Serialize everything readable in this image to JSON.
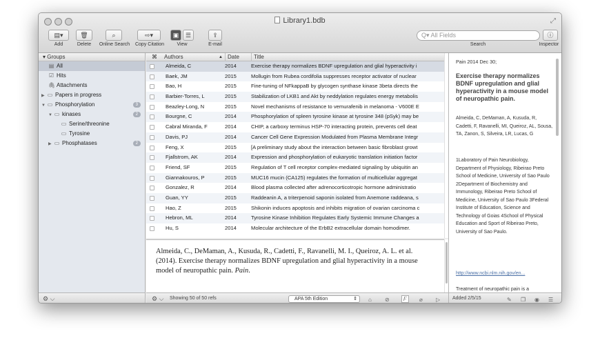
{
  "window": {
    "title": "Library1.bdb",
    "fullscreen_icon": "fullscreen-icon"
  },
  "toolbar": {
    "add_label": "Add",
    "add_glyph": "▤▾",
    "delete_label": "Delete",
    "delete_glyph": "🗑",
    "online_search_label": "Online Search",
    "online_search_glyph": "⌕",
    "copy_citation_label": "Copy Citation",
    "copy_citation_glyph": "⇨▾",
    "view_label": "View",
    "view_glyph_1": "▣",
    "view_glyph_2": "☰",
    "email_label": "E-mail",
    "email_glyph": "⇪",
    "search_placeholder": "Q▾ All Fields",
    "search_label": "Search",
    "inspector_label": "Inspector",
    "inspector_glyph": "ⓘ"
  },
  "sidebar": {
    "header": "Groups",
    "items": [
      {
        "label": "All",
        "icon": "▤"
      },
      {
        "label": "Hits",
        "icon": "☑"
      },
      {
        "label": "Attachments",
        "icon": "🖇"
      },
      {
        "label": "Papers in progress",
        "icon": "▭",
        "tri": "▶"
      },
      {
        "label": "Phosphorylation",
        "icon": "▭",
        "tri": "▼",
        "badge": "3"
      },
      {
        "label": "kinases",
        "icon": "▭",
        "tri": "▼",
        "badge": "2"
      },
      {
        "label": "Serine/threonine",
        "icon": "▭"
      },
      {
        "label": "Tyrosine",
        "icon": "▭"
      },
      {
        "label": "Phosphatases",
        "icon": "▭",
        "tri": "▶",
        "badge": "2"
      }
    ],
    "gear": "⚙︎ ⌵"
  },
  "list": {
    "col_flag": "⌘",
    "col_authors": "Authors",
    "col_date": "Date",
    "col_title": "Title",
    "sort_arrow": "▲",
    "rows": [
      {
        "author": "Almeida, C",
        "date": "2014",
        "title": "Exercise therapy normalizes BDNF upregulation and glial hyperactivity i"
      },
      {
        "author": "Baek, JM",
        "date": "2015",
        "title": "Mollugin from Rubea cordifolia suppresses receptor activator of nuclear"
      },
      {
        "author": "Bao, H",
        "date": "2015",
        "title": "Fine-tuning of NFkappaB by glycogen synthase kinase 3beta directs the"
      },
      {
        "author": "Barbier-Torres, L",
        "date": "2015",
        "title": "Stabilization of LKB1 and Akt by neddylation regulates energy metabolis"
      },
      {
        "author": "Beazley-Long, N",
        "date": "2015",
        "title": "Novel mechanisms of resistance to vemurafenib in melanoma - V600E E"
      },
      {
        "author": "Bourgne, C",
        "date": "2014",
        "title": "Phosphorylation of spleen tyrosine kinase at tyrosine 348 (pSyk) may be"
      },
      {
        "author": "Cabral Miranda, F",
        "date": "2014",
        "title": "CHIP, a carboxy terminus HSP-70 interacting protein, prevents cell deat"
      },
      {
        "author": "Davis, PJ",
        "date": "2014",
        "title": "Cancer Cell Gene Expression Modulated from Plasma Membrane Integr"
      },
      {
        "author": "Feng, X",
        "date": "2015",
        "title": "[A preliminary study about the interaction between basic fibroblast growt"
      },
      {
        "author": "Fjallstrom, AK",
        "date": "2014",
        "title": "Expression and phosphorylation of eukaryotic translation initiation factor"
      },
      {
        "author": "Friend, SF",
        "date": "2015",
        "title": "Regulation of T cell receptor complex-mediated signaling by ubiquitin an"
      },
      {
        "author": "Giannakouros, P",
        "date": "2015",
        "title": "MUC16 mucin (CA125) regulates the formation of multicellular aggregat"
      },
      {
        "author": "Gonzalez, R",
        "date": "2014",
        "title": "Blood plasma collected after adrenocorticotropic hormone administratio"
      },
      {
        "author": "Guan, YY",
        "date": "2015",
        "title": "Raddeanin A, a triterpenoid saponin isolated from Anemone raddeana, s"
      },
      {
        "author": "Hao, Z",
        "date": "2015",
        "title": "Shikonin induces apoptosis and inhibits migration of ovarian carcinoma c"
      },
      {
        "author": "Hebron, ML",
        "date": "2014",
        "title": "Tyrosine Kinase Inhibition Regulates Early Systemic Immune Changes a"
      },
      {
        "author": "Hu, S",
        "date": "2014",
        "title": "Molecular architecture of the ErbB2 extracellular domain homodimer."
      }
    ]
  },
  "preview": {
    "citation_main": "Almeida, C., DeMaman, A., Kusuda, R., Cadetti, F., Ravanelli, M. I., Queiroz, A. L. et al. (2014). Exercise therapy normalizes BDNF upregulation and glial hyperactivity in a mouse model of neuropathic pain. ",
    "citation_journal": "Pain",
    "citation_end": "."
  },
  "bottom": {
    "gear": "⚙︎ ⌵",
    "status": "Showing 50 of 50 refs",
    "style": "APA 5th Edition",
    "style_arrows": "⇕",
    "added": "Added 2/5/15"
  },
  "inspector": {
    "date": "Pain 2014 Dec 30;",
    "title": "Exercise therapy normalizes BDNF upregulation and glial hyperactivity in a mouse model of neuropathic pain.",
    "authors": "Almeida, C, DeMaman, A, Kusuda, R, Cadetti, F, Ravanelli, MI, Queiroz, AL, Sousa, TA, Zanon, S, Silveira, LR, Lucas, G",
    "affiliations": "1Laboratory of Pain Neurobiology, Department of Physiology, Ribeirao Preto School of Medicine, University of Sao Paulo 2Department of Biochemistry and Immunology, Ribeirao Preto School of Medicine, University of Sao Paulo 3Federal Institute of Education, Science and Technology of Goias 4School of Physical Education and Sport of Ribeirao Preto, University of Sao Paulo.",
    "link": "http://www.ncbi.nlm.nih.gov/en...",
    "trail": "Treatment of neuropathic pain is a"
  }
}
